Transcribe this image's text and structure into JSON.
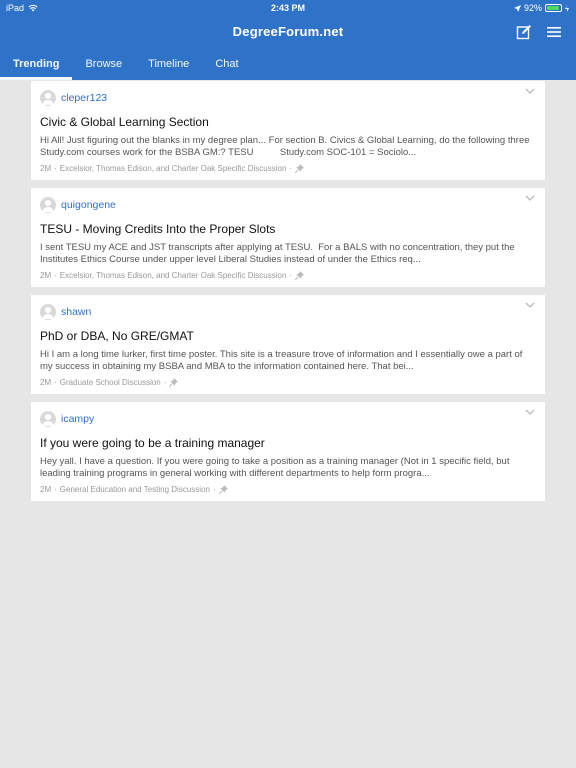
{
  "status_bar": {
    "carrier": "iPad",
    "time": "2:43 PM",
    "battery": "92%",
    "battery_level": 0.92,
    "icons": [
      "wifi-icon",
      "location-icon",
      "bluetooth-icon",
      "battery-icon"
    ]
  },
  "header": {
    "title": "DegreeForum.net",
    "actions": [
      "compose-icon",
      "menu-icon"
    ],
    "accent_color": "#2f73c9"
  },
  "tabs": [
    {
      "label": "Trending",
      "active": true
    },
    {
      "label": "Browse",
      "active": false
    },
    {
      "label": "Timeline",
      "active": false
    },
    {
      "label": "Chat",
      "active": false
    }
  ],
  "posts": [
    {
      "username": "cleper123",
      "title": "Civic & Global Learning Section",
      "excerpt": "Hi All! Just figuring out the blanks in my degree plan... For section B. Civics & Global Learning, do the following three Study.com courses work for the BSBA GM:? TESU          Study.com SOC-101 = Sociolo...",
      "age": "2M",
      "category": "Excelsior, Thomas Edison, and Charter Oak Specific Discussion"
    },
    {
      "username": "quigongene",
      "title": "TESU - Moving Credits Into the Proper Slots",
      "excerpt": "I sent TESU my ACE and JST transcripts after applying at TESU.  For a BALS with no concentration, they put the Institutes Ethics Course under upper level Liberal Studies instead of under the Ethics req...",
      "age": "2M",
      "category": "Excelsior, Thomas Edison, and Charter Oak Specific Discussion"
    },
    {
      "username": "shawn",
      "title": "PhD or DBA, No GRE/GMAT",
      "excerpt": "Hi I am a long time lurker, first time poster. This site is a treasure trove of information and I essentially owe a part of my success in obtaining my BSBA and MBA to the information contained here. That bei...",
      "age": "2M",
      "category": "Graduate School Discussion"
    },
    {
      "username": "icampy",
      "title": "If you were going to be a training manager",
      "excerpt": "Hey yall. I have a question. If you were going to take a position as a training manager (Not in 1 specific field, but leading training programs in general working with different departments to help form progra...",
      "age": "2M",
      "category": "General Education and Testing Discussion"
    }
  ]
}
